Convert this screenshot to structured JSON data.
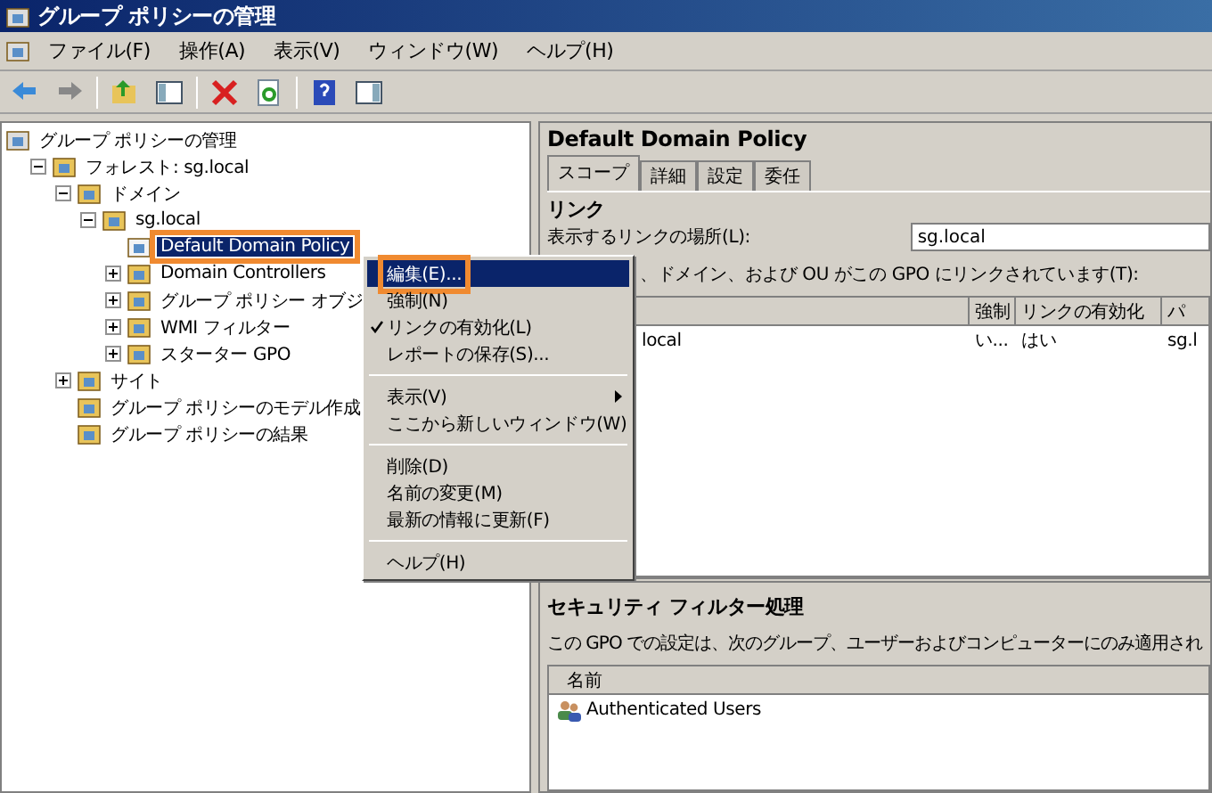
{
  "window": {
    "title": "グループ ポリシーの管理"
  },
  "menubar": [
    "ファイル(F)",
    "操作(A)",
    "表示(V)",
    "ウィンドウ(W)",
    "ヘルプ(H)"
  ],
  "tree": {
    "label": "グループ ポリシーの管理",
    "selected": false,
    "children": [
      {
        "label": "フォレスト: sg.local",
        "expanded": true,
        "selected": false,
        "children": [
          {
            "label": "ドメイン",
            "expanded": true,
            "selected": false,
            "children": [
              {
                "label": "sg.local",
                "expanded": true,
                "selected": false,
                "children": [
                  {
                    "label": "Default Domain Policy",
                    "selected": true,
                    "highlighted": true
                  },
                  {
                    "label": "Domain Controllers",
                    "expanded": false,
                    "selected": false
                  },
                  {
                    "label": "グループ ポリシー オブジ",
                    "expanded": false,
                    "selected": false
                  },
                  {
                    "label": "WMI フィルター",
                    "expanded": false,
                    "selected": false
                  },
                  {
                    "label": "スターター GPO",
                    "expanded": false,
                    "selected": false
                  }
                ]
              }
            ]
          },
          {
            "label": "サイト",
            "expanded": false,
            "selected": false
          },
          {
            "label": "グループ ポリシーのモデル作成",
            "selected": false
          },
          {
            "label": "グループ ポリシーの結果",
            "selected": false
          }
        ]
      }
    ]
  },
  "context_menu": [
    {
      "kind": "item",
      "label": "編集(E)...",
      "selected": true,
      "highlighted": true
    },
    {
      "kind": "item",
      "label": "強制(N)",
      "selected": false
    },
    {
      "kind": "item",
      "label": "リンクの有効化(L)",
      "selected": false,
      "checked": true
    },
    {
      "kind": "item",
      "label": "レポートの保存(S)...",
      "selected": false
    },
    {
      "kind": "separator"
    },
    {
      "kind": "item",
      "label": "表示(V)",
      "selected": false,
      "submenu": true
    },
    {
      "kind": "item",
      "label": "ここから新しいウィンドウ(W)",
      "selected": false
    },
    {
      "kind": "separator"
    },
    {
      "kind": "item",
      "label": "削除(D)",
      "selected": false
    },
    {
      "kind": "item",
      "label": "名前の変更(M)",
      "selected": false
    },
    {
      "kind": "item",
      "label": "最新の情報に更新(F)",
      "selected": false
    },
    {
      "kind": "separator"
    },
    {
      "kind": "item",
      "label": "ヘルプ(H)",
      "selected": false
    }
  ],
  "details": {
    "title": "Default Domain Policy",
    "tabs": [
      {
        "label": "スコープ",
        "selected": true
      },
      {
        "label": "詳細",
        "selected": false
      },
      {
        "label": "設定",
        "selected": false
      },
      {
        "label": "委任",
        "selected": false
      }
    ],
    "links": {
      "heading": "リンク",
      "location_label": "表示するリンクの場所(L):",
      "location_value": "sg.local",
      "description": "、ドメイン、および OU がこの GPO にリンクされています(T):",
      "table": {
        "columns": [
          "",
          "強制",
          "リンクの有効化",
          "パ"
        ],
        "rows": [
          {
            "cells": [
              "local",
              "い...",
              "はい",
              "sg.l"
            ]
          }
        ]
      }
    },
    "security": {
      "heading": "セキュリティ フィルター処理",
      "description": "この GPO での設定は、次のグループ、ユーザーおよびコンピューターにのみ適用され",
      "table": {
        "columns": [
          "名前"
        ],
        "rows": [
          {
            "name": "Authenticated Users"
          }
        ]
      }
    }
  }
}
